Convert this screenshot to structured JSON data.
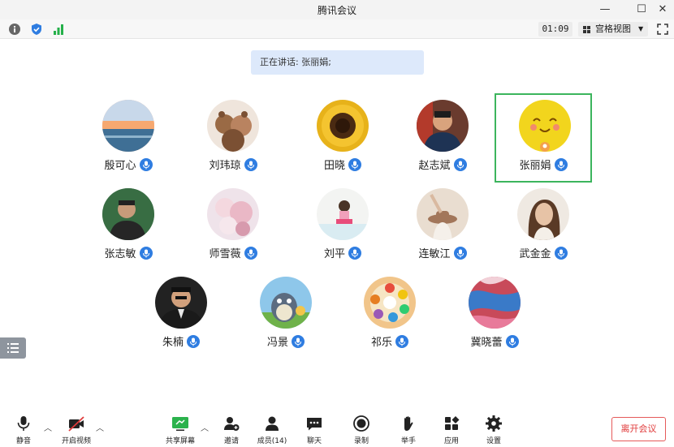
{
  "window": {
    "title": "腾讯会议"
  },
  "infobar": {
    "timer": "01:09",
    "view_label": "宫格视图",
    "colors": {
      "info": "#777777",
      "shield": "#2f7de1",
      "signal": "#25b04a"
    }
  },
  "speaking_banner": "正在讲话: 张丽娟;",
  "participants": [
    {
      "name": "殷可心",
      "icon": "ocean-sunset"
    },
    {
      "name": "刘玮琼",
      "icon": "teddy-bears"
    },
    {
      "name": "田晓",
      "icon": "sunflower"
    },
    {
      "name": "赵志斌",
      "icon": "man-photo"
    },
    {
      "name": "张丽娟",
      "icon": "yellow-emoji",
      "speaking": true
    },
    {
      "name": "张志敏",
      "icon": "man-green-bg"
    },
    {
      "name": "师雪薇",
      "icon": "roses"
    },
    {
      "name": "刘平",
      "icon": "child-reading"
    },
    {
      "name": "连敏江",
      "icon": "girl-hat"
    },
    {
      "name": "武金金",
      "icon": "woman-photo"
    },
    {
      "name": "朱楠",
      "icon": "man-suit"
    },
    {
      "name": "冯景",
      "icon": "totoro"
    },
    {
      "name": "祁乐",
      "icon": "colorful-plate"
    },
    {
      "name": "冀晓蕾",
      "icon": "abstract-paint"
    }
  ],
  "toolbar": {
    "mute": "静音",
    "video": "开启视频",
    "share": "共享屏幕",
    "invite": "邀请",
    "members": "成员(14)",
    "chat": "聊天",
    "record": "录制",
    "raise_hand": "举手",
    "apps": "应用",
    "settings": "设置",
    "leave": "离开会议",
    "colors": {
      "share_green": "#2bb24c",
      "leave_red": "#e03a3a"
    }
  },
  "mic_color": "#2f7de1"
}
